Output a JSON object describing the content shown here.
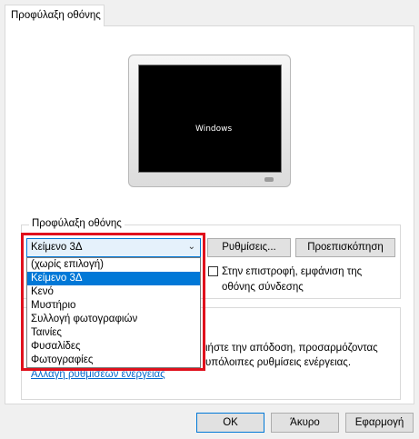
{
  "tab": {
    "label": "Προφύλαξη οθόνης"
  },
  "preview": {
    "screen_logo": "Windows"
  },
  "screensaver": {
    "group_label": "Προφύλαξη οθόνης",
    "selected": "Κείμενο 3Δ",
    "settings_button": "Ρυθμίσεις...",
    "preview_button": "Προεπισκόπηση",
    "resume_label": "Στην επιστροφή, εμφάνιση της οθόνης σύνδεσης",
    "options": [
      "(χωρίς επιλογή)",
      "Κείμενο 3Δ",
      "Κενό",
      "Μυστήριο",
      "Συλλογή φωτογραφιών",
      "Ταινίες",
      "Φυσαλίδες",
      "Φωτογραφίες"
    ],
    "selected_index": 1
  },
  "power": {
    "text": "ιήστε την απόδοση, προσαρμόζοντας υπόλοιπες ρυθμίσεις ενέργειας.",
    "link": "Αλλαγή ρυθμίσεων ενέργειας"
  },
  "footer": {
    "ok": "OK",
    "cancel": "Άκυρο",
    "apply": "Εφαρμογή"
  },
  "colors": {
    "selection": "#0078d7",
    "highlight_box": "#e0101c",
    "link": "#0066cc"
  }
}
